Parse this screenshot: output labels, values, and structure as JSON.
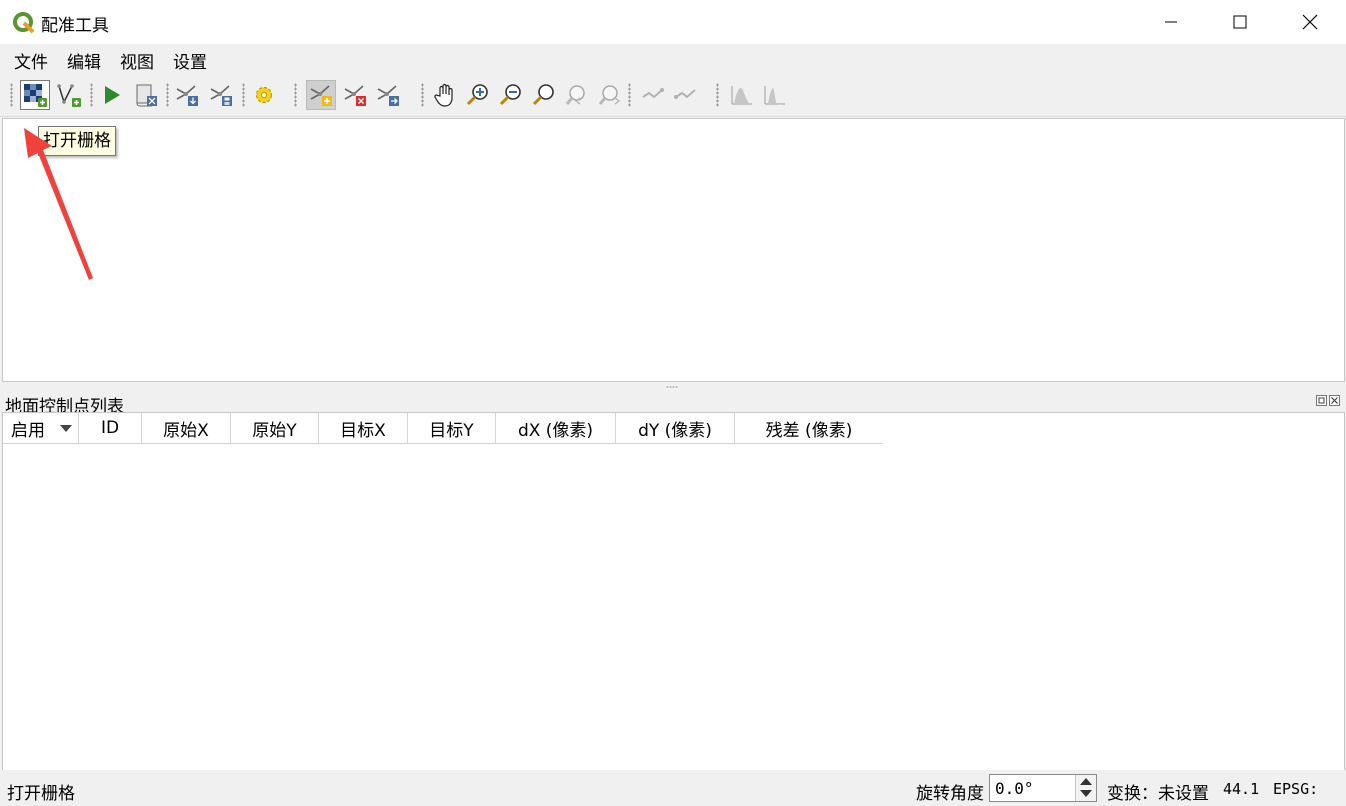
{
  "window": {
    "title": "配准工具"
  },
  "menu": {
    "items": [
      "文件",
      "编辑",
      "视图",
      "设置"
    ]
  },
  "tooltip": {
    "text": "打开栅格"
  },
  "gcp_panel": {
    "title": "地面控制点列表",
    "columns": [
      "启用",
      "ID",
      "原始X",
      "原始Y",
      "目标X",
      "目标Y",
      "dX (像素)",
      "dY (像素)",
      "残差 (像素)"
    ]
  },
  "status": {
    "message": "打开栅格",
    "rotation_label": "旋转角度",
    "rotation_value": "0.0°",
    "transform_label": "变换：未设置",
    "coord": "44.1",
    "epsg": "EPSG:"
  },
  "colors": {
    "accent": "#589632",
    "arrow": "#f0413c",
    "tooltip_bg": "#ffffe1"
  },
  "toolbar": {
    "buttons": [
      "open-raster-icon",
      "add-vector-icon",
      "start-georeferencing-icon",
      "generate-gdal-script-icon",
      "load-gcp-icon",
      "save-gcp-icon",
      "transformation-settings-icon",
      "add-point-icon",
      "delete-point-icon",
      "move-point-icon",
      "pan-icon",
      "zoom-in-icon",
      "zoom-out-icon",
      "zoom-to-layer-icon",
      "zoom-last-icon",
      "zoom-next-icon",
      "link-georeferencer-icon",
      "link-qgis-icon",
      "full-histogram-stretch-icon",
      "local-histogram-stretch-icon"
    ]
  }
}
